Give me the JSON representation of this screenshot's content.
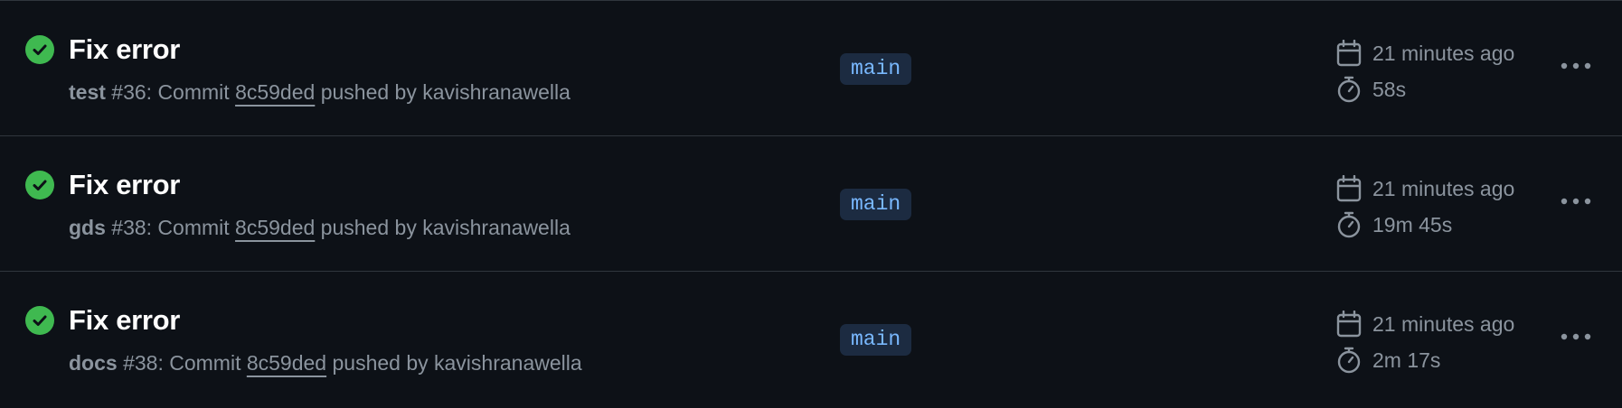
{
  "runs": [
    {
      "title": "Fix error",
      "workflow": "test",
      "run_number": "#36",
      "commit_label": ": Commit ",
      "sha": "8c59ded",
      "pushed_by": " pushed by kavishranawella",
      "branch": "main",
      "time_ago": "21 minutes ago",
      "duration": "58s",
      "status_icon": "check-circle-icon"
    },
    {
      "title": "Fix error",
      "workflow": "gds",
      "run_number": "#38",
      "commit_label": ": Commit ",
      "sha": "8c59ded",
      "pushed_by": " pushed by kavishranawella",
      "branch": "main",
      "time_ago": "21 minutes ago",
      "duration": "19m 45s",
      "status_icon": "check-circle-icon"
    },
    {
      "title": "Fix error",
      "workflow": "docs",
      "run_number": "#38",
      "commit_label": ": Commit ",
      "sha": "8c59ded",
      "pushed_by": " pushed by kavishranawella",
      "branch": "main",
      "time_ago": "21 minutes ago",
      "duration": "2m 17s",
      "status_icon": "check-circle-icon"
    }
  ],
  "colors": {
    "background": "#0d1117",
    "success": "#3fb950",
    "muted_text": "#8b949e",
    "branch_text": "#79b8ff",
    "branch_bg": "#1c2b41"
  }
}
